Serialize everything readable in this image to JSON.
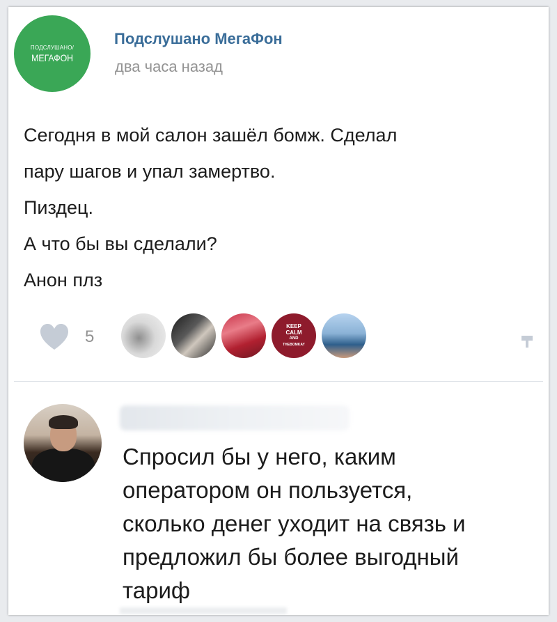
{
  "post": {
    "group_avatar": {
      "small_text": "ПОДСЛУШАНО/",
      "big_text": "МЕГАФОН",
      "color": "#3aa756"
    },
    "group_name": "Подслушано МегаФон",
    "time": "два часа назад",
    "text_lines": [
      "Сегодня в мой салон зашёл бомж. Сделал",
      "пару шагов и упал замертво.",
      "Пиздец.",
      "А что бы вы сделали?",
      "Анон плз"
    ],
    "likes": {
      "count": "5",
      "icon": "heart-icon",
      "liker_badge_text": [
        "KEEP",
        "CALM",
        "AND",
        "THEBOMKAY"
      ]
    },
    "share_icon": "share-icon"
  },
  "comment": {
    "text_lines": [
      "Спросил бы у него, каким",
      "оператором он пользуется,",
      "сколько денег уходит на связь и",
      "предложил бы более выгодный",
      "тариф"
    ]
  },
  "colors": {
    "link": "#3a6d99",
    "muted": "#939393",
    "text": "#1c1c1c",
    "brand": "#3aa756"
  }
}
